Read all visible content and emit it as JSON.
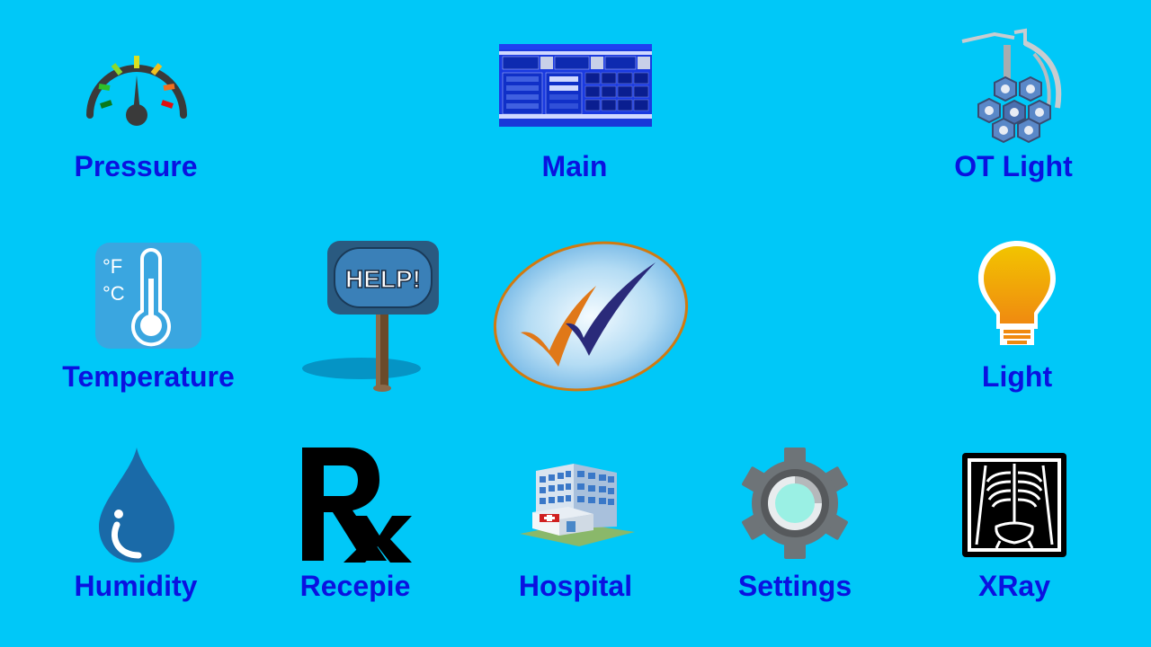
{
  "tiles": [
    {
      "label": "Pressure",
      "icon": "pressure-gauge-icon"
    },
    {
      "label": "Main",
      "icon": "main-dashboard-icon"
    },
    {
      "label": "OT Light",
      "icon": "surgical-light-icon"
    },
    {
      "label": "Temperature",
      "icon": "thermometer-icon"
    },
    {
      "label": "Light",
      "icon": "light-bulb-icon"
    },
    {
      "label": "Humidity",
      "icon": "water-drop-icon"
    },
    {
      "label": "Recepie",
      "icon": "rx-icon"
    },
    {
      "label": "Hospital",
      "icon": "hospital-building-icon"
    },
    {
      "label": "Settings",
      "icon": "gear-icon"
    },
    {
      "label": "XRay",
      "icon": "xray-icon"
    }
  ],
  "help_sign": {
    "text": "HELP!",
    "icon": "help-sign-icon"
  },
  "checkmark": {
    "icon": "checkmark-icon"
  },
  "temperature_units": {
    "fahrenheit": "°F",
    "celsius": "°C"
  },
  "rx_symbol": "Rx",
  "colors": {
    "background": "#00c8f8",
    "label": "#0a12e0"
  }
}
